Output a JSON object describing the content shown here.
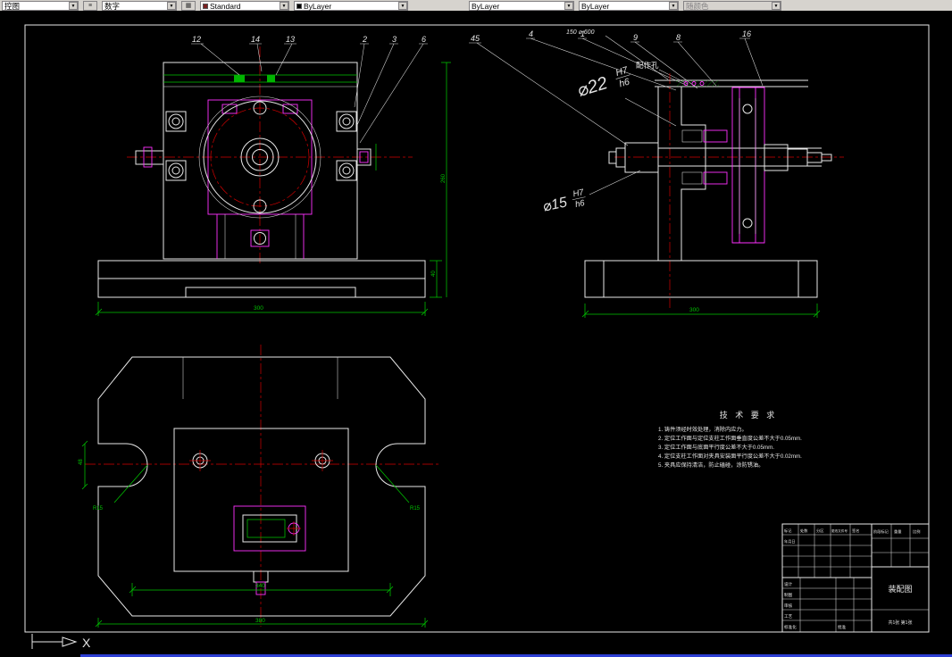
{
  "toolbar": {
    "layer_control": "控图",
    "text_style": "数字",
    "dim_style": "Standard",
    "color": "ByLayer",
    "linetype": "ByLayer",
    "lineweight": "ByLayer",
    "plot_style": "随颜色"
  },
  "colors": {
    "canvas": "#000000",
    "outline": "#e8e8e8",
    "hidden_detail": "#ff30ff",
    "dimension": "#00c400",
    "centerline": "#d40000",
    "toolbar_bg": "#d6d3ce"
  },
  "balloons": {
    "left": [
      "12",
      "14",
      "13",
      "2",
      "3",
      "6"
    ],
    "right": [
      "45",
      "4",
      "1",
      "9",
      "8",
      "16"
    ]
  },
  "callouts": {
    "top_note": "150 ⌀ 600",
    "match_hole": "配作孔",
    "fit22_prefix": "⌀22",
    "fit22_upper": "H7",
    "fit22_lower": "h6",
    "fit15_prefix": "⌀15",
    "fit15_upper": "H7",
    "fit15_lower": "h6"
  },
  "dimensions": {
    "front_base_width": "300",
    "front_base_height": "40",
    "front_height": "260",
    "section_base_width": "300",
    "plan_inner_width": "340",
    "plan_outer_width": "380",
    "slot_width": "48",
    "notch_left": "R15",
    "notch_right": "R15"
  },
  "tech_req": {
    "title": "技 术 要 求",
    "items": [
      "1. 铸件须经时效处理，消除内应力。",
      "2. 定位工作面与定位支柱工作面垂直度公差不大于0.05mm.",
      "3. 定位工作面与底面平行度公差不大于0.05mm.",
      "4. 定位支柱工作面对夹具安装面平行度公差不大于0.02mm.",
      "5. 夹具应保持清洁，防止磕碰，涂防锈油。"
    ]
  },
  "title_block": {
    "change_headers": [
      "标记",
      "处数",
      "分区",
      "更改文件号",
      "签名",
      "年月日"
    ],
    "sign_labels": [
      "设计",
      "制图",
      "审核",
      "工艺",
      "标准化",
      "批准"
    ],
    "stage_label": "阶段标记",
    "weight_label": "重量",
    "scale_label": "比例",
    "sheet_note": "共1张 第1张",
    "title": "装配图"
  },
  "ucs": {
    "x_axis": "X"
  }
}
